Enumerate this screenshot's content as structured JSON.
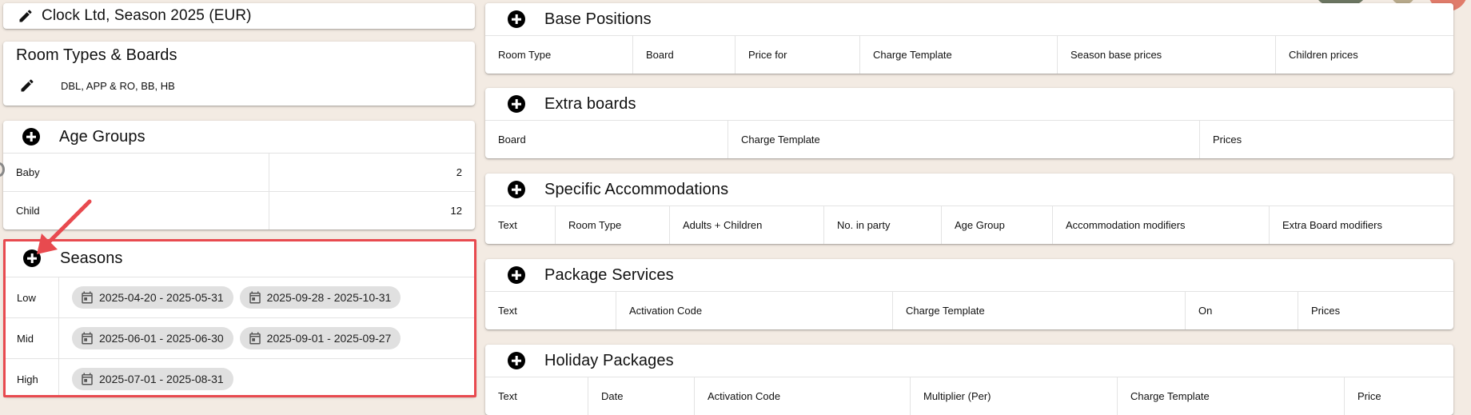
{
  "header": {
    "title": "Clock Ltd, Season 2025 (EUR)"
  },
  "room_types": {
    "title": "Room Types & Boards",
    "summary": "DBL, APP & RO, BB, HB"
  },
  "age_groups": {
    "title": "Age Groups",
    "rows": [
      {
        "name": "Baby",
        "value": "2"
      },
      {
        "name": "Child",
        "value": "12"
      }
    ]
  },
  "seasons": {
    "title": "Seasons",
    "rows": [
      {
        "name": "Low",
        "ranges": [
          "2025-04-20 - 2025-05-31",
          "2025-09-28 - 2025-10-31"
        ]
      },
      {
        "name": "Mid",
        "ranges": [
          "2025-06-01 - 2025-06-30",
          "2025-09-01 - 2025-09-27"
        ]
      },
      {
        "name": "High",
        "ranges": [
          "2025-07-01 - 2025-08-31"
        ]
      }
    ]
  },
  "base_positions": {
    "title": "Base Positions",
    "columns": [
      "Room Type",
      "Board",
      "Price for",
      "Charge Template",
      "Season base prices",
      "Children prices"
    ]
  },
  "extra_boards": {
    "title": "Extra boards",
    "columns": [
      "Board",
      "Charge Template",
      "Prices"
    ]
  },
  "specific_accommodations": {
    "title": "Specific Accommodations",
    "columns": [
      "Text",
      "Room Type",
      "Adults + Children",
      "No. in party",
      "Age Group",
      "Accommodation modifiers",
      "Extra Board modifiers"
    ]
  },
  "package_services": {
    "title": "Package Services",
    "columns": [
      "Text",
      "Activation Code",
      "Charge Template",
      "On",
      "Prices"
    ]
  },
  "holiday_packages": {
    "title": "Holiday Packages",
    "columns": [
      "Text",
      "Date",
      "Activation Code",
      "Multiplier (Per)",
      "Charge Template",
      "Price"
    ]
  },
  "colors": {
    "background": "#f3ebe3",
    "annotation": "#e84a4f"
  },
  "icons": {
    "edit": "pencil-icon",
    "add": "plus-circle-icon",
    "date": "calendar-icon"
  }
}
